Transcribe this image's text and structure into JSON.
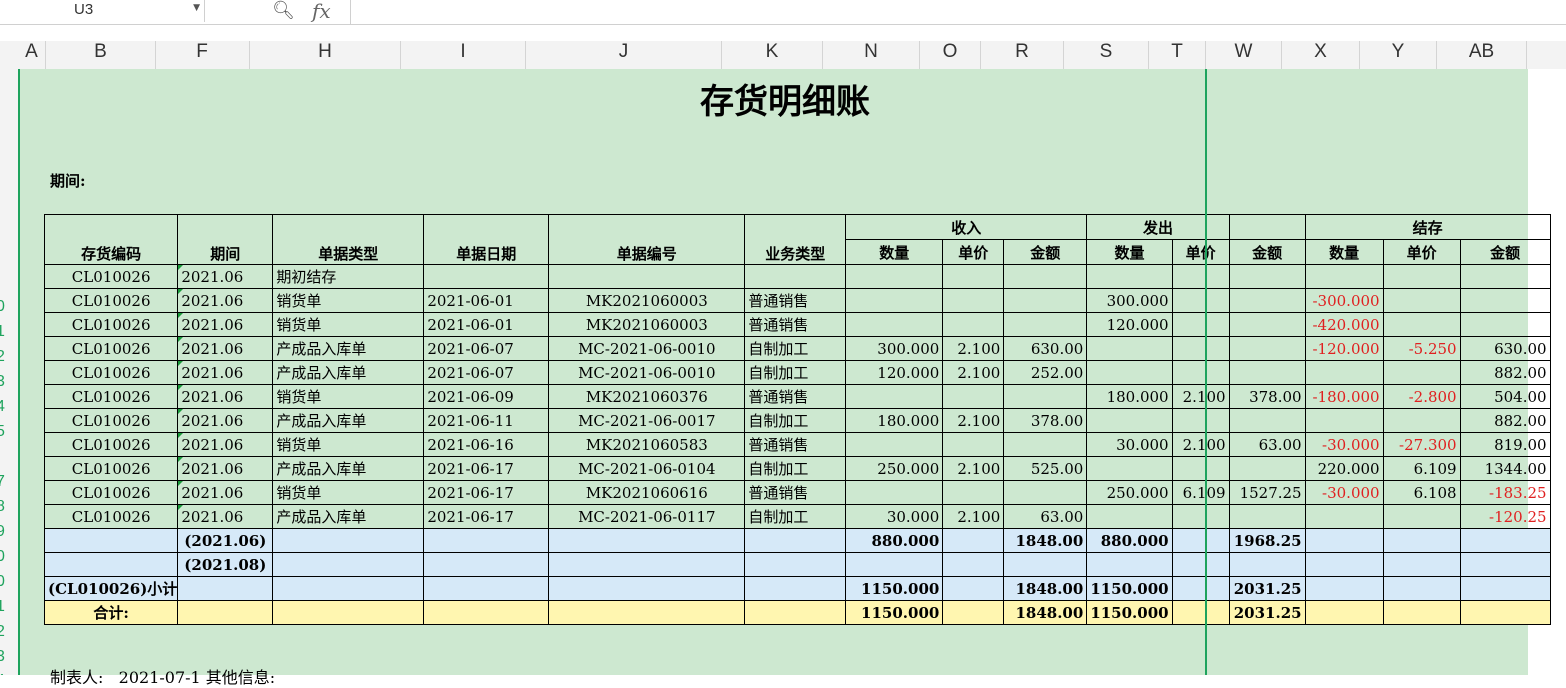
{
  "formula_bar": {
    "cell_ref": "U3",
    "dropdown_icon": "chevron-down-icon",
    "zoom_icon": "zoom-icon",
    "fx_label": "fx"
  },
  "columns": [
    "A",
    "B",
    "F",
    "H",
    "I",
    "J",
    "K",
    "N",
    "O",
    "R",
    "S",
    "T",
    "W",
    "X",
    "Y",
    "AB"
  ],
  "row_numbers": [
    "0",
    "1",
    "2",
    "3",
    "4",
    "5",
    "7",
    "8",
    "9",
    "0",
    "0",
    "1",
    "2",
    "3",
    "4"
  ],
  "title": "存货明细账",
  "period_label": "期间:",
  "header": {
    "code": "存货编码",
    "period": "期间",
    "doc_type": "单据类型",
    "doc_date": "单据日期",
    "doc_no": "单据编号",
    "biz_type": "业务类型",
    "income": "收入",
    "issue": "发出",
    "balance": "结存",
    "qty": "数量",
    "price": "单价",
    "amount": "金额"
  },
  "rows": [
    [
      "CL010026",
      "2021.06",
      "期初结存",
      "",
      "",
      "",
      "",
      "",
      "",
      "",
      "",
      "",
      "",
      "",
      ""
    ],
    [
      "CL010026",
      "2021.06",
      "销货单",
      "2021-06-01",
      "MK2021060003",
      "普通销售",
      "",
      "",
      "",
      "300.000",
      "",
      "",
      "-300.000",
      "",
      ""
    ],
    [
      "CL010026",
      "2021.06",
      "销货单",
      "2021-06-01",
      "MK2021060003",
      "普通销售",
      "",
      "",
      "",
      "120.000",
      "",
      "",
      "-420.000",
      "",
      ""
    ],
    [
      "CL010026",
      "2021.06",
      "产成品入库单",
      "2021-06-07",
      "MC-2021-06-0010",
      "自制加工",
      "300.000",
      "2.100",
      "630.00",
      "",
      "",
      "",
      "-120.000",
      "-5.250",
      "630.00"
    ],
    [
      "CL010026",
      "2021.06",
      "产成品入库单",
      "2021-06-07",
      "MC-2021-06-0010",
      "自制加工",
      "120.000",
      "2.100",
      "252.00",
      "",
      "",
      "",
      "",
      "",
      "882.00"
    ],
    [
      "CL010026",
      "2021.06",
      "销货单",
      "2021-06-09",
      "MK2021060376",
      "普通销售",
      "",
      "",
      "",
      "180.000",
      "2.100",
      "378.00",
      "-180.000",
      "-2.800",
      "504.00"
    ],
    [
      "CL010026",
      "2021.06",
      "产成品入库单",
      "2021-06-11",
      "MC-2021-06-0017",
      "自制加工",
      "180.000",
      "2.100",
      "378.00",
      "",
      "",
      "",
      "",
      "",
      "882.00"
    ],
    [
      "CL010026",
      "2021.06",
      "销货单",
      "2021-06-16",
      "MK2021060583",
      "普通销售",
      "",
      "",
      "",
      "30.000",
      "2.100",
      "63.00",
      "-30.000",
      "-27.300",
      "819.00"
    ],
    [
      "CL010026",
      "2021.06",
      "产成品入库单",
      "2021-06-17",
      "MC-2021-06-0104",
      "自制加工",
      "250.000",
      "2.100",
      "525.00",
      "",
      "",
      "",
      "220.000",
      "6.109",
      "1344.00"
    ],
    [
      "CL010026",
      "2021.06",
      "销货单",
      "2021-06-17",
      "MK2021060616",
      "普通销售",
      "",
      "",
      "",
      "250.000",
      "6.109",
      "1527.25",
      "-30.000",
      "6.108",
      "-183.25"
    ],
    [
      "CL010026",
      "2021.06",
      "产成品入库单",
      "2021-06-17",
      "MC-2021-06-0117",
      "自制加工",
      "30.000",
      "2.100",
      "63.00",
      "",
      "",
      "",
      "",
      "",
      "-120.25"
    ]
  ],
  "subtotals": [
    [
      "",
      "(2021.06)",
      "",
      "",
      "",
      "",
      "880.000",
      "",
      "1848.00",
      "880.000",
      "",
      "1968.25",
      "",
      "",
      ""
    ],
    [
      "",
      "(2021.08)",
      "",
      "",
      "",
      "",
      "",
      "",
      "",
      "",
      "",
      "",
      "",
      "",
      ""
    ],
    [
      "(CL010026)小计",
      "",
      "",
      "",
      "",
      "",
      "1150.000",
      "",
      "1848.00",
      "1150.000",
      "",
      "2031.25",
      "",
      "",
      ""
    ]
  ],
  "total": [
    "合计:",
    "",
    "",
    "",
    "",
    "",
    "1150.000",
    "",
    "1848.00",
    "1150.000",
    "",
    "2031.25",
    "",
    "",
    ""
  ],
  "footer": "制表人:   2021-07-1 其他信息:",
  "colors": {
    "sheet_bg": "#cde8d0",
    "subtotal_bg": "#d6e9f8",
    "total_bg": "#fff6b0",
    "negative": "#e02020",
    "accent": "#1ea35d"
  }
}
